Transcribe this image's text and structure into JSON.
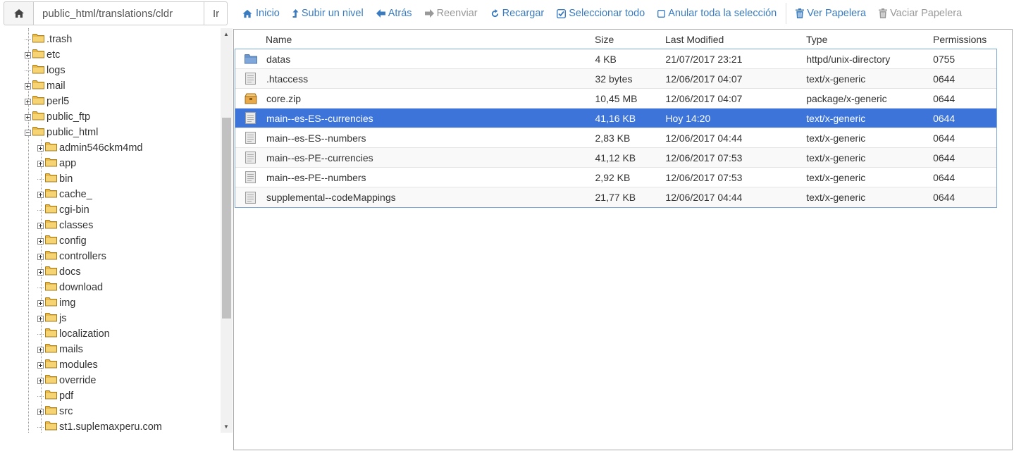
{
  "pathbar": {
    "home_icon": "home-icon",
    "path_value": "public_html/translations/cldr",
    "go_label": "Ir"
  },
  "toolbar": {
    "home": {
      "label": "Inicio",
      "icon": "home-icon"
    },
    "up": {
      "label": "Subir un nivel",
      "icon": "level-up-icon"
    },
    "back": {
      "label": "Atrás",
      "icon": "arrow-left-icon"
    },
    "forward": {
      "label": "Reenviar",
      "icon": "arrow-right-icon"
    },
    "reload": {
      "label": "Recargar",
      "icon": "refresh-icon"
    },
    "select_all": {
      "label": "Seleccionar todo",
      "icon": "check-square-icon"
    },
    "unselect_all": {
      "label": "Anular toda la selección",
      "icon": "square-icon"
    },
    "view_trash": {
      "label": "Ver Papelera",
      "icon": "trash-icon"
    },
    "empty_trash": {
      "label": "Vaciar Papelera",
      "icon": "trash-icon"
    }
  },
  "tree": {
    "root_items": [
      {
        "label": ".trash",
        "expandable": false
      },
      {
        "label": "etc",
        "expandable": true
      },
      {
        "label": "logs",
        "expandable": false
      },
      {
        "label": "mail",
        "expandable": true
      },
      {
        "label": "perl5",
        "expandable": true
      },
      {
        "label": "public_ftp",
        "expandable": true
      },
      {
        "label": "public_html",
        "expandable": true,
        "expanded": true
      }
    ],
    "child_items": [
      {
        "label": "admin546ckm4md",
        "expandable": true
      },
      {
        "label": "app",
        "expandable": true
      },
      {
        "label": "bin",
        "expandable": false
      },
      {
        "label": "cache_",
        "expandable": true
      },
      {
        "label": "cgi-bin",
        "expandable": false
      },
      {
        "label": "classes",
        "expandable": true
      },
      {
        "label": "config",
        "expandable": true
      },
      {
        "label": "controllers",
        "expandable": true
      },
      {
        "label": "docs",
        "expandable": true
      },
      {
        "label": "download",
        "expandable": false
      },
      {
        "label": "img",
        "expandable": true
      },
      {
        "label": "js",
        "expandable": true
      },
      {
        "label": "localization",
        "expandable": false
      },
      {
        "label": "mails",
        "expandable": true
      },
      {
        "label": "modules",
        "expandable": true
      },
      {
        "label": "override",
        "expandable": true
      },
      {
        "label": "pdf",
        "expandable": false
      },
      {
        "label": "src",
        "expandable": true
      },
      {
        "label": "st1.suplemaxperu.com",
        "expandable": false
      }
    ]
  },
  "table": {
    "columns": {
      "name": "Name",
      "size": "Size",
      "modified": "Last Modified",
      "type": "Type",
      "perms": "Permissions"
    },
    "rows": [
      {
        "icon": "folder-icon",
        "name": "datas",
        "size": "4 KB",
        "modified": "21/07/2017 23:21",
        "type": "httpd/unix-directory",
        "perms": "0755",
        "selected": false
      },
      {
        "icon": "file-icon",
        "name": ".htaccess",
        "size": "32 bytes",
        "modified": "12/06/2017 04:07",
        "type": "text/x-generic",
        "perms": "0644",
        "selected": false
      },
      {
        "icon": "archive-icon",
        "name": "core.zip",
        "size": "10,45 MB",
        "modified": "12/06/2017 04:07",
        "type": "package/x-generic",
        "perms": "0644",
        "selected": false
      },
      {
        "icon": "file-icon",
        "name": "main--es-ES--currencies",
        "size": "41,16 KB",
        "modified": "Hoy 14:20",
        "type": "text/x-generic",
        "perms": "0644",
        "selected": true
      },
      {
        "icon": "file-icon",
        "name": "main--es-ES--numbers",
        "size": "2,83 KB",
        "modified": "12/06/2017 04:44",
        "type": "text/x-generic",
        "perms": "0644",
        "selected": false
      },
      {
        "icon": "file-icon",
        "name": "main--es-PE--currencies",
        "size": "41,12 KB",
        "modified": "12/06/2017 07:53",
        "type": "text/x-generic",
        "perms": "0644",
        "selected": false
      },
      {
        "icon": "file-icon",
        "name": "main--es-PE--numbers",
        "size": "2,92 KB",
        "modified": "12/06/2017 07:53",
        "type": "text/x-generic",
        "perms": "0644",
        "selected": false
      },
      {
        "icon": "file-icon",
        "name": "supplemental--codeMappings",
        "size": "21,77 KB",
        "modified": "12/06/2017 04:44",
        "type": "text/x-generic",
        "perms": "0644",
        "selected": false
      }
    ]
  },
  "colors": {
    "accent": "#3a7bbf",
    "selected_row": "#3d74d9",
    "folder": "#e8b94a"
  }
}
